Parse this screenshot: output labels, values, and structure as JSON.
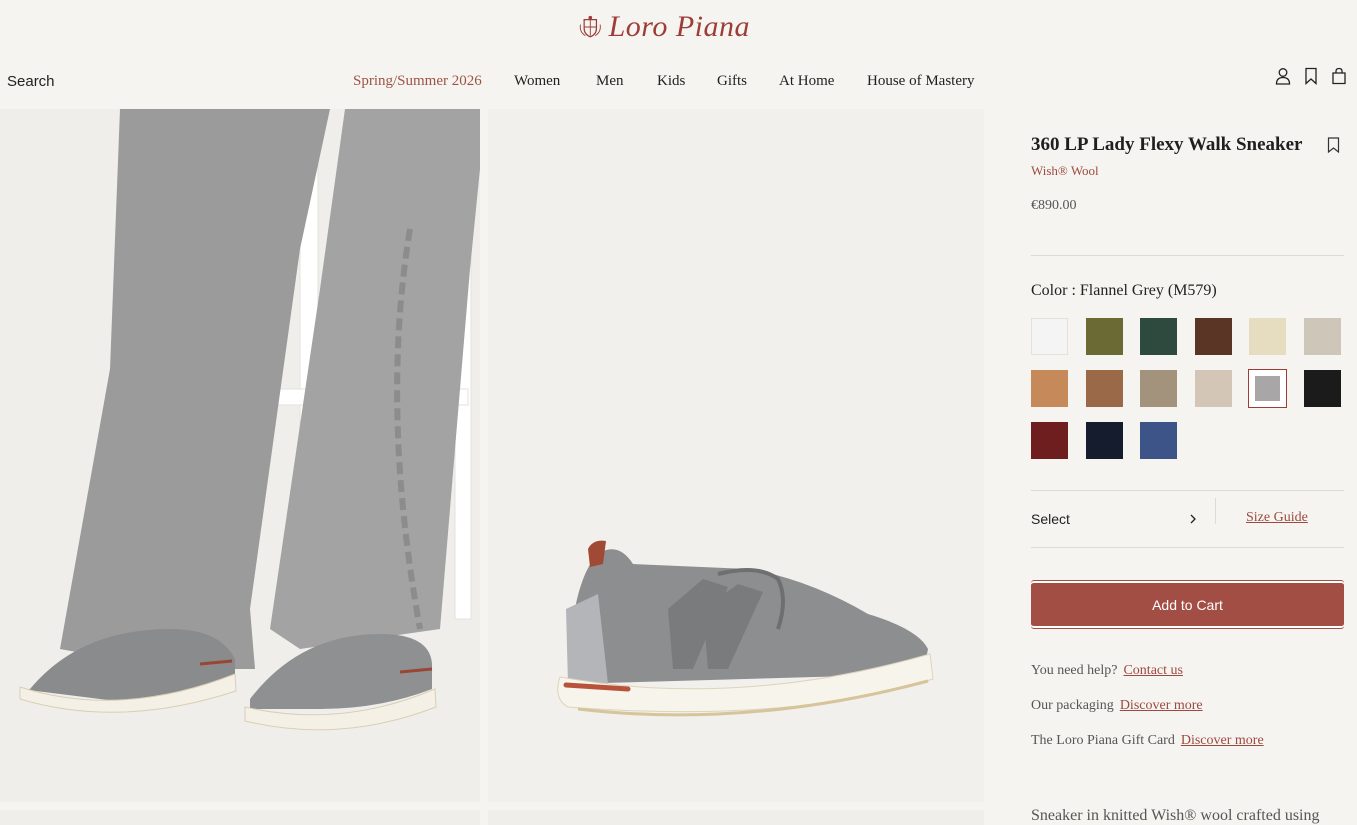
{
  "header": {
    "brand": "Loro Piana",
    "search_label": "Search",
    "nav": [
      "Spring/Summer 2026",
      "Women",
      "Men",
      "Kids",
      "Gifts",
      "At Home",
      "House of Mastery"
    ],
    "icons": [
      "user-icon",
      "bookmark-icon",
      "shopping-bag-icon"
    ]
  },
  "product": {
    "title": "360 LP Lady Flexy Walk Sneaker",
    "material": "Wish® Wool",
    "price": "€890.00",
    "color_label": "Color : Flannel Grey (M579)",
    "swatch_colors": [
      "#f4f4f4",
      "#6b6a35",
      "#2e4a3f",
      "#5a3424",
      "#e6dcc0",
      "#cfc6ba",
      "#c68a5a",
      "#9a6a48",
      "#a3937c",
      "#d3c6b6",
      "#a8a6a6",
      "#1b1b1b",
      "#6e1e1e",
      "#141c2e",
      "#3d5488"
    ],
    "selected_swatch": 10,
    "select_label": "Select",
    "size_guide_label": "Size Guide",
    "add_to_cart_label": "Add to Cart",
    "help": [
      {
        "text": "You need help?",
        "link": "Contact us"
      },
      {
        "text": "Our packaging",
        "link": "Discover more"
      },
      {
        "text": "The Loro Piana Gift Card",
        "link": "Discover more"
      }
    ],
    "description_start": "Sneaker in knitted Wish® wool crafted using"
  },
  "colors": {
    "accent": "#9c3d36",
    "button": "#a34e45",
    "background": "#f6f4f1"
  }
}
